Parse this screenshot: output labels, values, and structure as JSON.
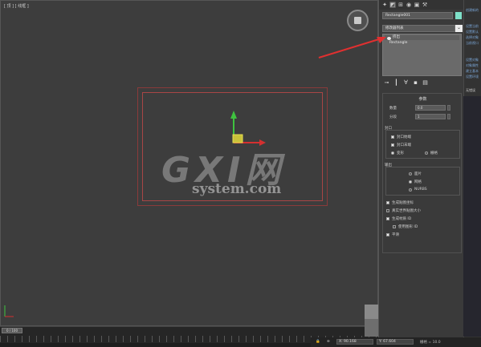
{
  "viewport": {
    "label": "[ 顶 ] [ 线框 ]",
    "viewcube": "viewcube-icon"
  },
  "command_panel": {
    "tabs": [
      "create-icon",
      "modify-icon",
      "hierarchy-icon",
      "motion-icon",
      "display-icon",
      "utilities-icon"
    ],
    "object_name": "Rectangle001",
    "object_color": "#7ee0c8",
    "modifier_list": "修改器列表",
    "stack": [
      "挤出",
      "Rectangle"
    ],
    "stack_tools": [
      "pin-stack-icon",
      "show-end-result-icon",
      "make-unique-icon",
      "remove-modifier-icon",
      "configure-sets-icon"
    ],
    "parameters": {
      "title": "参数",
      "amount_label": "数量",
      "amount_value": "0.0",
      "segments_label": "分段",
      "segments_value": "1",
      "capping": {
        "title": "封口",
        "cap_start": "封口始端",
        "cap_end": "封口末端",
        "morph": "变形",
        "grid": "栅格"
      },
      "output": {
        "title": "输出",
        "patch": "面片",
        "mesh": "网格",
        "nurbs": "NURBS"
      },
      "checks": [
        "生成贴图坐标",
        "真实世界贴图大小",
        "生成材质 ID",
        "使用图形 ID",
        "平滑"
      ]
    }
  },
  "timeline": {
    "slider": "0 / 100"
  },
  "statusbar": {
    "x_value": "X: 90.168",
    "y_value": "Y: 67.604",
    "grid": "栅格 = 10.0"
  },
  "side_strip": [
    "创建新的",
    "设置当前",
    "设置默认",
    "选择对象",
    "当前视口",
    "设置对象",
    "对象属性",
    "建立基本",
    "设置环境"
  ],
  "side_strip_lower": "无错误",
  "watermark": {
    "brand": "GXI网",
    "domain": "system.com"
  }
}
